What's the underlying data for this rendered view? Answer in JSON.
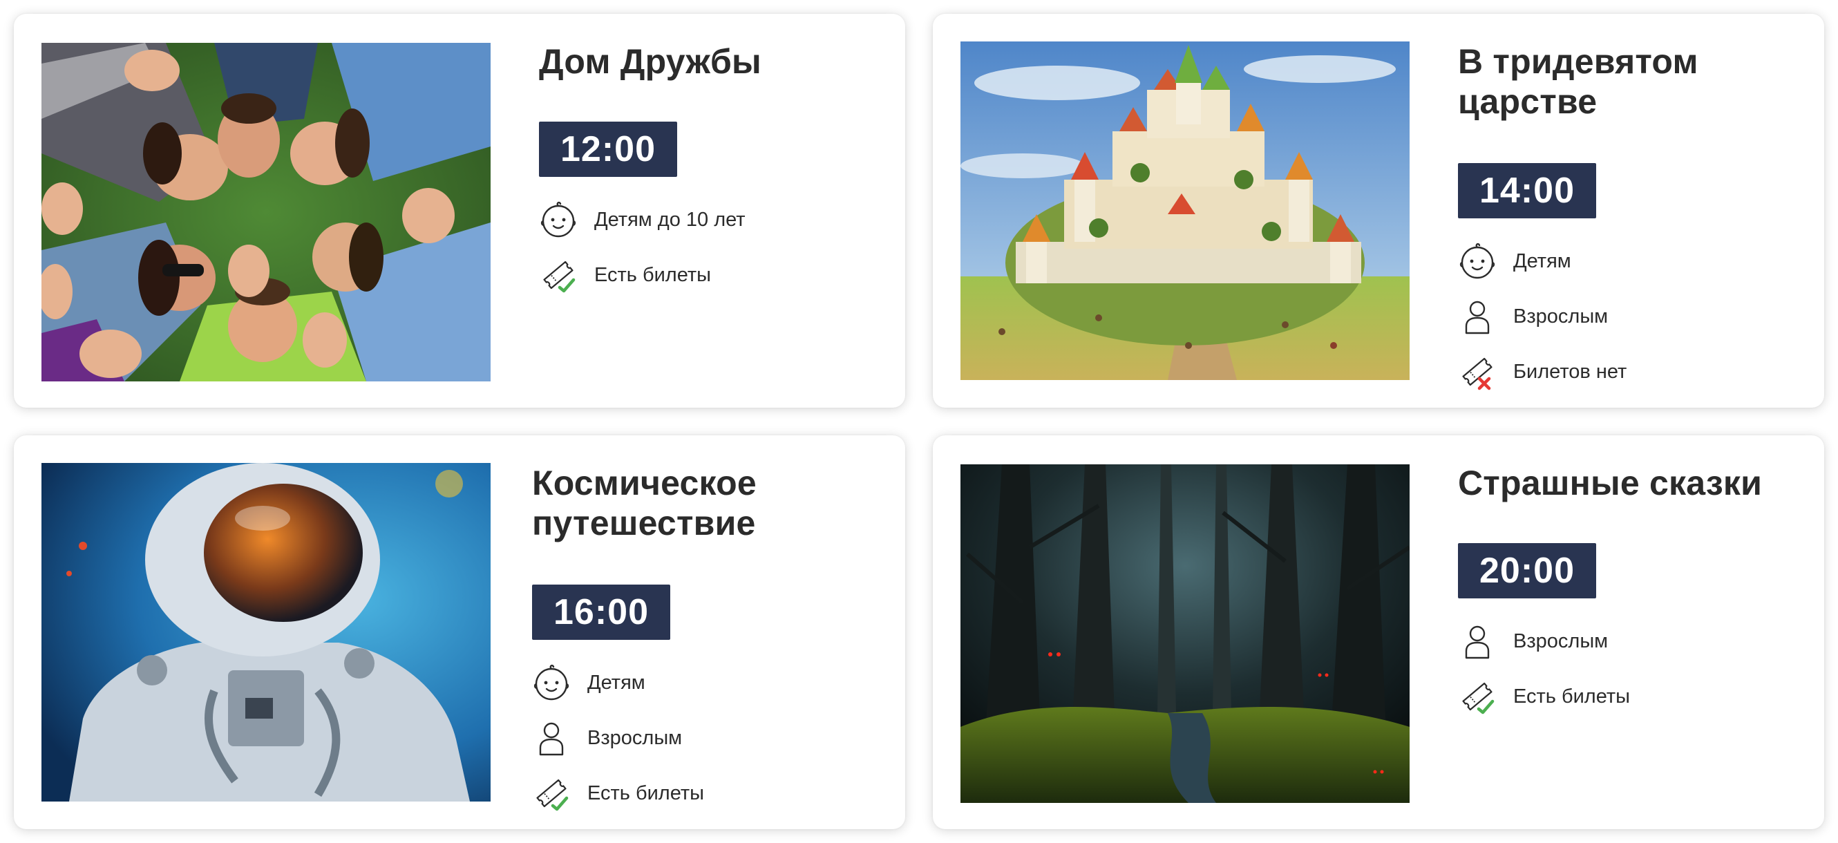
{
  "events": [
    {
      "title": "Дом Дружбы",
      "time": "12:00",
      "image": "friends-lying-on-grass-photo",
      "features": [
        {
          "icon": "baby-face-icon",
          "label": "Детям до 10 лет"
        },
        {
          "icon": "ticket-available-icon",
          "label": "Есть билеты"
        }
      ]
    },
    {
      "title": "В тридевятом царстве",
      "time": "14:00",
      "image": "fairy-tale-castle-illustration",
      "features": [
        {
          "icon": "baby-face-icon",
          "label": "Детям"
        },
        {
          "icon": "adult-person-icon",
          "label": "Взрослым"
        },
        {
          "icon": "ticket-unavailable-icon",
          "label": "Билетов нет"
        }
      ]
    },
    {
      "title": "Космическое путешествие",
      "time": "16:00",
      "image": "astronaut-painting",
      "features": [
        {
          "icon": "baby-face-icon",
          "label": "Детям"
        },
        {
          "icon": "adult-person-icon",
          "label": "Взрослым"
        },
        {
          "icon": "ticket-available-icon",
          "label": "Есть билеты"
        }
      ]
    },
    {
      "title": "Страшные сказки",
      "time": "20:00",
      "image": "dark-forest-painting",
      "features": [
        {
          "icon": "adult-person-icon",
          "label": "Взрослым"
        },
        {
          "icon": "ticket-available-icon",
          "label": "Есть билеты"
        }
      ]
    }
  ],
  "colors": {
    "time_badge_bg": "#293451",
    "time_badge_text": "#ffffff",
    "title_text": "#2b2b2b",
    "ticket_available_mark": "#4caf50",
    "ticket_unavailable_mark": "#e53935"
  }
}
